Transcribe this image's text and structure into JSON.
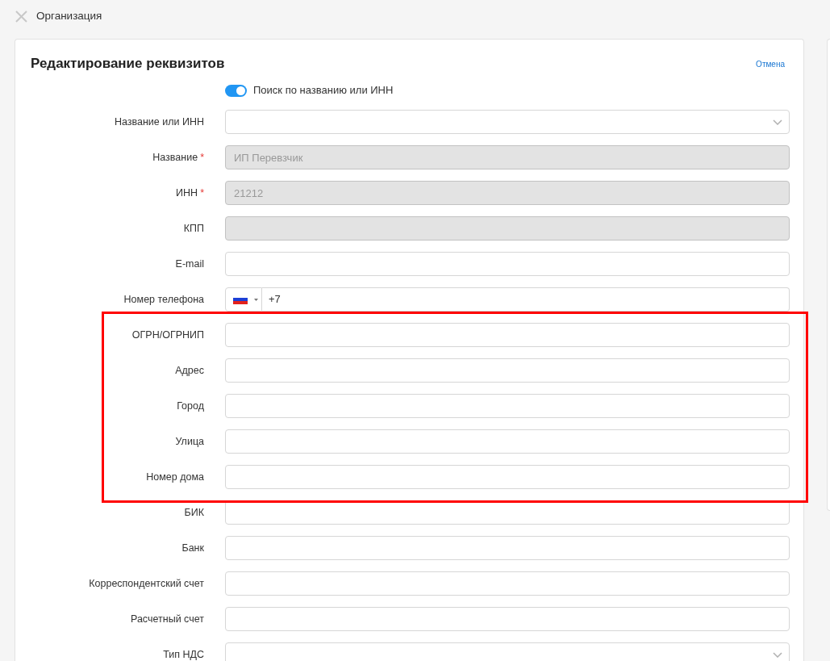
{
  "header": {
    "title": "Организация"
  },
  "card": {
    "title": "Редактирование реквизитов",
    "cancel_link": "Отмена",
    "required_mark": "*",
    "search_toggle": {
      "label": "Поиск по названию или ИНН",
      "on": true
    },
    "fields": [
      {
        "label": "Название или ИНН",
        "kind": "select",
        "required": false,
        "disabled": false,
        "highlighted": false
      },
      {
        "label": "Название",
        "kind": "text",
        "required": true,
        "disabled": true,
        "value": "ИП Перевзчик",
        "highlighted": false
      },
      {
        "label": "ИНН",
        "kind": "text",
        "required": true,
        "disabled": true,
        "value": "21212",
        "highlighted": false
      },
      {
        "label": "КПП",
        "kind": "text",
        "required": false,
        "disabled": true,
        "highlighted": false
      },
      {
        "label": "E-mail",
        "kind": "text",
        "required": false,
        "disabled": false,
        "highlighted": false
      },
      {
        "label": "Номер телефона",
        "kind": "phone",
        "required": false,
        "disabled": false,
        "value": "+7",
        "highlighted": false
      },
      {
        "label": "ОГРН/ОГРНИП",
        "kind": "text",
        "required": false,
        "disabled": false,
        "highlighted": true
      },
      {
        "label": "Адрес",
        "kind": "text",
        "required": false,
        "disabled": false,
        "highlighted": true
      },
      {
        "label": "Город",
        "kind": "text",
        "required": false,
        "disabled": false,
        "highlighted": true
      },
      {
        "label": "Улица",
        "kind": "text",
        "required": false,
        "disabled": false,
        "highlighted": true
      },
      {
        "label": "Номер дома",
        "kind": "text",
        "required": false,
        "disabled": false,
        "highlighted": true
      },
      {
        "label": "БИК",
        "kind": "text",
        "required": false,
        "disabled": false,
        "highlighted": false
      },
      {
        "label": "Банк",
        "kind": "text",
        "required": false,
        "disabled": false,
        "highlighted": false
      },
      {
        "label": "Корреспондентский счет",
        "kind": "text",
        "required": false,
        "disabled": false,
        "highlighted": false
      },
      {
        "label": "Расчетный счет",
        "kind": "text",
        "required": false,
        "disabled": false,
        "highlighted": false
      },
      {
        "label": "Тип НДС",
        "kind": "select",
        "required": false,
        "disabled": false,
        "highlighted": false
      }
    ]
  }
}
